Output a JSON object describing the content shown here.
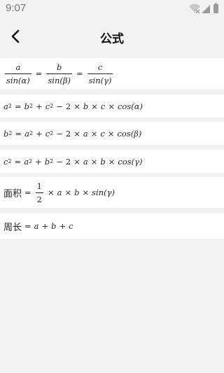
{
  "status_bar": {
    "time": "9:07"
  },
  "header": {
    "title": "公式"
  },
  "formulas": {
    "sine_rule": {
      "a": "a",
      "b": "b",
      "c": "c",
      "sin_a": "sin(α)",
      "sin_b": "sin(β)",
      "sin_c": "sin(γ)"
    },
    "cos_a": {
      "lhs": "a",
      "t1": "b",
      "t2": "c",
      "coef": "2",
      "x1": "b",
      "x2": "c",
      "fn": "cos(α)"
    },
    "cos_b": {
      "lhs": "b",
      "t1": "a",
      "t2": "c",
      "coef": "2",
      "x1": "a",
      "x2": "c",
      "fn": "cos(β)"
    },
    "cos_c": {
      "lhs": "c",
      "t1": "a",
      "t2": "b",
      "coef": "2",
      "x1": "a",
      "x2": "b",
      "fn": "cos(γ)"
    },
    "area": {
      "label": "面积",
      "num": "1",
      "den": "2",
      "x1": "a",
      "x2": "b",
      "fn": "sin(γ)"
    },
    "perimeter": {
      "label": "周长",
      "t1": "a",
      "t2": "b",
      "t3": "c"
    }
  },
  "symbols": {
    "eq": "=",
    "plus": "+",
    "minus": "−",
    "times": "×",
    "sq": "2"
  }
}
